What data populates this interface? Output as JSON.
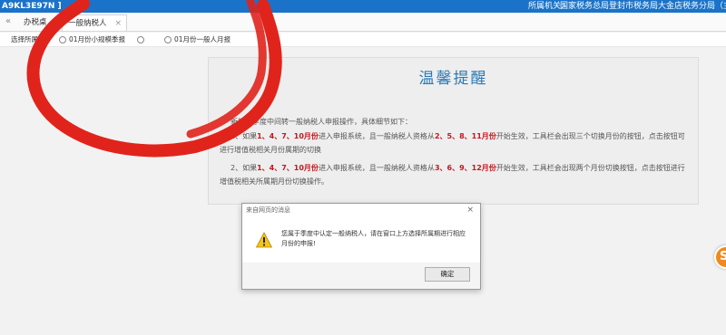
{
  "topbar": {
    "taxpayer_id": "A9KL3E97N ]",
    "org_label": "所属机关:",
    "org_name": "国家税务总局登封市税务局大金店税务分局（主）",
    "bg_color": "#1a73c8"
  },
  "tabs": [
    {
      "label": "办税桌面"
    },
    {
      "label": "一般纳税人",
      "close": "×"
    }
  ],
  "tab_back_icon": "«",
  "period": {
    "label": "选择所属期",
    "options": [
      {
        "label": "01月份小规模季报"
      },
      {
        "label": ""
      },
      {
        "label": "01月份一般人月报"
      }
    ]
  },
  "notice": {
    "title": "温馨提醒",
    "intro": "新规则季度中间转一般纳税人申报操作，具体细节如下：",
    "rule1": {
      "a": "1、如果",
      "months": "1、4、7、10月份",
      "b": "进入申报系统，且一般纳税人资格从",
      "start": "2、5、8、11月份",
      "c": "开始生效，工具栏会出现三个切换月份的按钮，点击按钮可进行增值税相关月份属期的切换"
    },
    "rule2": {
      "a": "2、如果",
      "months": "1、4、7、10月份",
      "b": "进入申报系统，且一般纳税人资格从",
      "start": "3、6、9、12月份",
      "c": "开始生效，工具栏会出现两个月份切换按钮，点击按钮进行增值税相关所属期月份切换操作。"
    },
    "highlight_color": "#c8141e",
    "title_color": "#2a7ab5"
  },
  "dialog": {
    "title": "来自网页的消息",
    "close": "×",
    "message": "您属于季度中认定一般纳税人，请在窗口上方选择所属期进行相应月份的申报!",
    "ok_label": "确定",
    "icon": "warning-icon"
  },
  "float_widget": {
    "label": "S",
    "icon": "service-icon",
    "color": "#f08a1c"
  },
  "annotation_color": "#e0241c"
}
